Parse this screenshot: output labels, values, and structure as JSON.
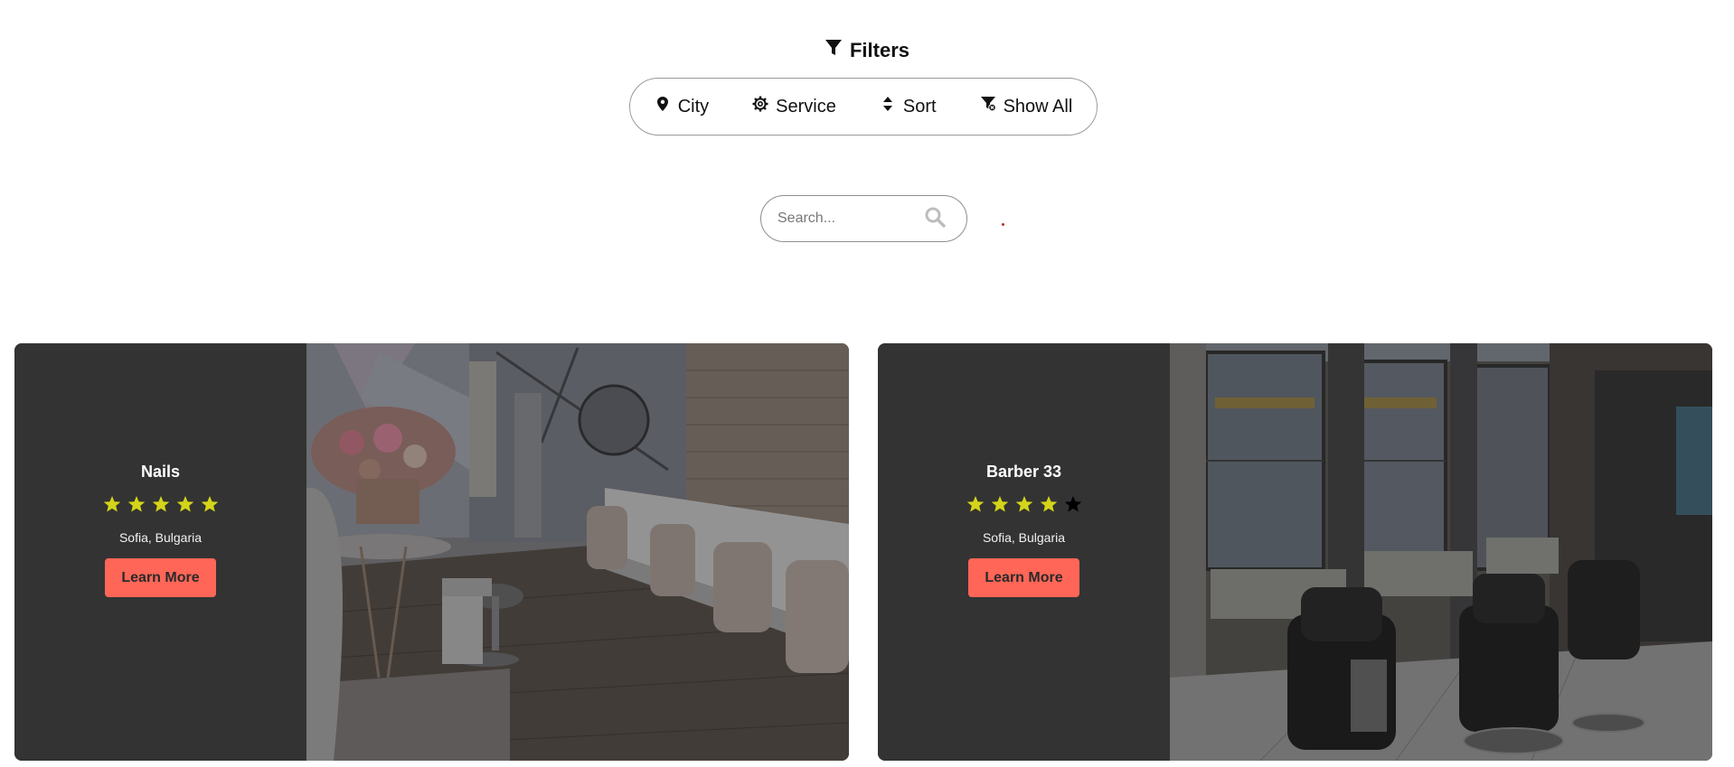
{
  "filters": {
    "title": "Filters",
    "buttons": {
      "city": "City",
      "service": "Service",
      "sort": "Sort",
      "show_all": "Show All"
    }
  },
  "search": {
    "placeholder": "Search...",
    "value": ""
  },
  "cards": [
    {
      "title": "Nails",
      "rating": 5,
      "rating_max": 5,
      "location": "Sofia, Bulgaria",
      "button": "Learn More"
    },
    {
      "title": "Barber 33",
      "rating": 4,
      "rating_max": 5,
      "location": "Sofia, Bulgaria",
      "button": "Learn More"
    }
  ],
  "colors": {
    "card_background": "#333333",
    "star_filled": "#d4d41a",
    "star_empty": "#000000",
    "button_background": "#ff6657"
  },
  "icons": {
    "filters": "filter-icon",
    "city": "map-pin-icon",
    "service": "gear-icon",
    "sort": "sort-icon",
    "show_all": "filter-clear-icon",
    "search": "search-icon",
    "rating": "star-icon"
  }
}
